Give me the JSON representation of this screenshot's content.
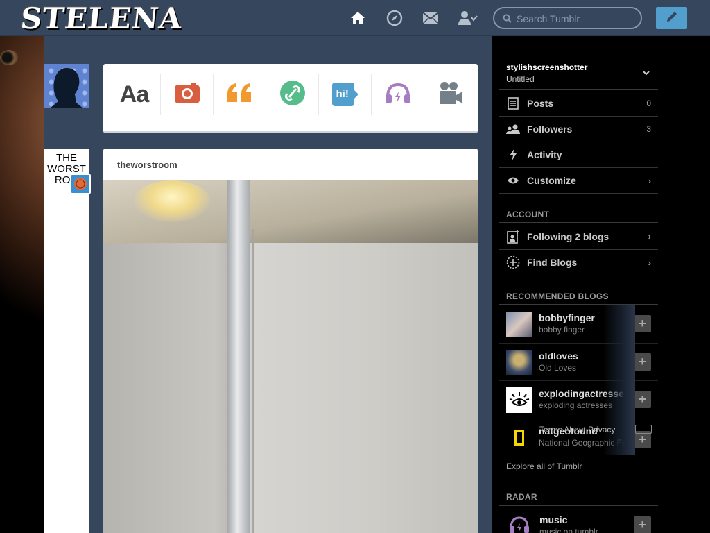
{
  "header": {
    "logo_text": "STELENA",
    "search_placeholder": "Search Tumblr",
    "nav": [
      "home-icon",
      "explore-icon",
      "inbox-icon",
      "account-icon"
    ],
    "compose_icon": "pencil-icon",
    "accent": "#529ecc",
    "bg": "#36465d"
  },
  "post_types": [
    {
      "label": "Aa",
      "name": "text",
      "color": "#444444"
    },
    {
      "label": "photo",
      "name": "camera-icon",
      "color": "#d95e40"
    },
    {
      "label": "quote",
      "name": "quote-icon",
      "color": "#f2992e"
    },
    {
      "label": "link",
      "name": "link-icon",
      "color": "#56bc8a"
    },
    {
      "label": "hi!",
      "name": "chat-icon",
      "color": "#529ecc"
    },
    {
      "label": "audio",
      "name": "headphones-icon",
      "color": "#a77dc2"
    },
    {
      "label": "video",
      "name": "video-camera-icon",
      "color": "#748089"
    }
  ],
  "post": {
    "blog_name": "theworstroom",
    "avatar_text": "THE WORST ROO"
  },
  "sidebar": {
    "account_name": "stylishscreenshotter",
    "account_subtitle": "Untitled",
    "rows": [
      {
        "label": "Posts",
        "count": "0"
      },
      {
        "label": "Followers",
        "count": "3"
      },
      {
        "label": "Activity",
        "count": ""
      },
      {
        "label": "Customize",
        "count": ""
      }
    ],
    "account_title": "ACCOUNT",
    "account_rows": [
      {
        "label": "Following 2 blogs"
      },
      {
        "label": "Find Blogs"
      }
    ],
    "recommended_title": "RECOMMENDED BLOGS",
    "recommended": [
      {
        "name": "bobbyfinger",
        "subtitle": "bobby finger"
      },
      {
        "name": "oldloves",
        "subtitle": "Old Loves"
      },
      {
        "name": "explodingactresses",
        "subtitle": "exploding actresses"
      },
      {
        "name": "natgeofound",
        "subtitle": "National Geographic Fo"
      }
    ],
    "footer_overlay": "Terms  About  Privacy",
    "explore_link": "Explore all of Tumblr",
    "radar_title": "RADAR",
    "radar_item": {
      "name": "music",
      "subtitle": "music on tumblr"
    }
  }
}
